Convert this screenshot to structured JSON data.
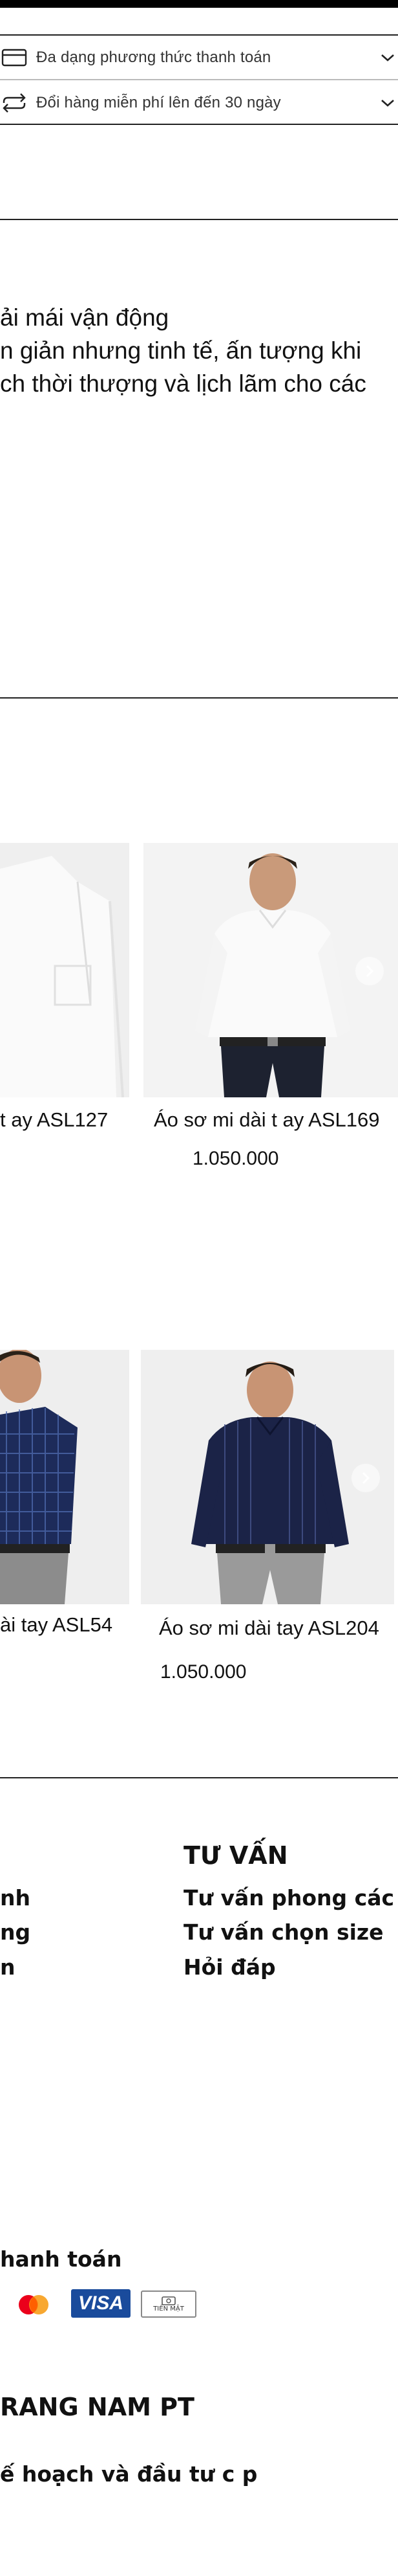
{
  "policies": [
    {
      "icon": "credit-card-icon",
      "text": "Đa dạng phương thức thanh toán"
    },
    {
      "icon": "exchange-arrows-icon",
      "text": "Đổi hàng miễn phí lên đến 30 ngày"
    }
  ],
  "description": {
    "lines": [
      "ải mái vận động",
      "n giản nhưng tinh tế, ấn tượng khi",
      "ch thời thượng và lịch lãm cho các"
    ]
  },
  "products_row1": [
    {
      "name": "t ay ASL127",
      "price": ""
    },
    {
      "name": "Áo sơ mi dài t ay ASL169",
      "price": "1.050.000"
    }
  ],
  "products_row2": [
    {
      "name": "ài tay ASL54",
      "price": ""
    },
    {
      "name": "Áo sơ mi dài tay ASL204",
      "price": "1.050.000"
    }
  ],
  "footer": {
    "col1_links": [
      "nh",
      "ng",
      "n"
    ],
    "col2_title": "TƯ VẤN",
    "col2_links": [
      "Tư  vấn phong các",
      "Tư  vấn chọn size",
      "Hỏi  đáp"
    ],
    "payment_title": "hanh toán",
    "payments": [
      {
        "icon": "mastercard-icon"
      },
      {
        "icon": "visa-icon",
        "label": "VISA"
      },
      {
        "icon": "cash-icon",
        "label": "TIỀN MẶT"
      }
    ],
    "brand_title": "RANG NAM PT",
    "brand_link": "ế  hoạch và   đầu tư   c p"
  },
  "colors": {
    "text": "#111111",
    "divider": "#222222",
    "visa": "#1a4b9c",
    "mastercard_red": "#eb001b",
    "mastercard_yellow": "#f79e1b"
  }
}
